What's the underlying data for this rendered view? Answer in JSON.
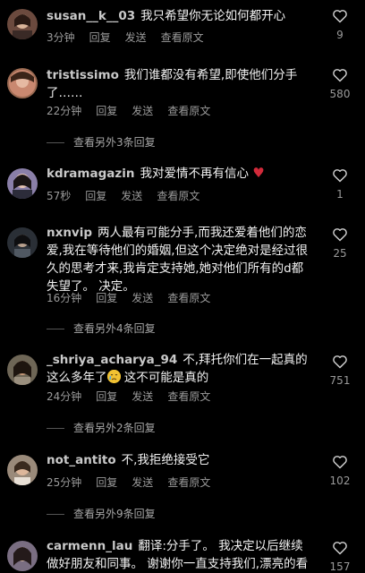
{
  "comments": [
    {
      "user": "susan__k__03",
      "text": "我只希望你无论如何都开心",
      "time": "3分钟",
      "reply": "回复",
      "send": "发送",
      "translate": "查看原文",
      "likes": "9"
    },
    {
      "user": "tristissimo",
      "text": "我们谁都没有希望,即使他们分手了……",
      "time": "22分钟",
      "reply": "回复",
      "send": "发送",
      "translate": "查看原文",
      "likes": "580",
      "more_replies": "查看另外3条回复"
    },
    {
      "user": "kdramagazin",
      "text": "我对爱情不再有信心",
      "emoji": "broken-heart",
      "time": "57秒",
      "reply": "回复",
      "send": "发送",
      "translate": "查看原文",
      "likes": "1"
    },
    {
      "user": "nxnvip",
      "text": "两人最有可能分手,而我还爱着他们的恋爱,我在等待他们的婚姻,但这个决定绝对是经过很久的思考才来,我肯定支持她,她对他们所有的d都失望了。 决定。",
      "time": "16分钟",
      "reply": "回复",
      "send": "发送",
      "translate": "查看原文",
      "likes": "25",
      "more_replies": "查看另外4条回复"
    },
    {
      "user": "_shriya_acharya_94",
      "text_a": "不,拜托你们在一起真的这么多年了",
      "text_b": " 这不可能是真的",
      "emoji": "crying-face",
      "time": "24分钟",
      "reply": "回复",
      "send": "发送",
      "translate": "查看原文",
      "likes": "751",
      "more_replies": "查看另外2条回复"
    },
    {
      "user": "not_antito",
      "text": "不,我拒绝接受它",
      "time": "25分钟",
      "reply": "回复",
      "send": "发送",
      "translate": "查看原文",
      "likes": "102",
      "more_replies": "查看另外9条回复"
    },
    {
      "user": "carmenn_lau",
      "text": "翻译:分手了。 我决定以后继续做好朋友和同事。 谢谢你一直支持我们,漂亮的看着我们",
      "likes": "157"
    }
  ],
  "icons": {
    "like": "heart-outline-icon"
  }
}
